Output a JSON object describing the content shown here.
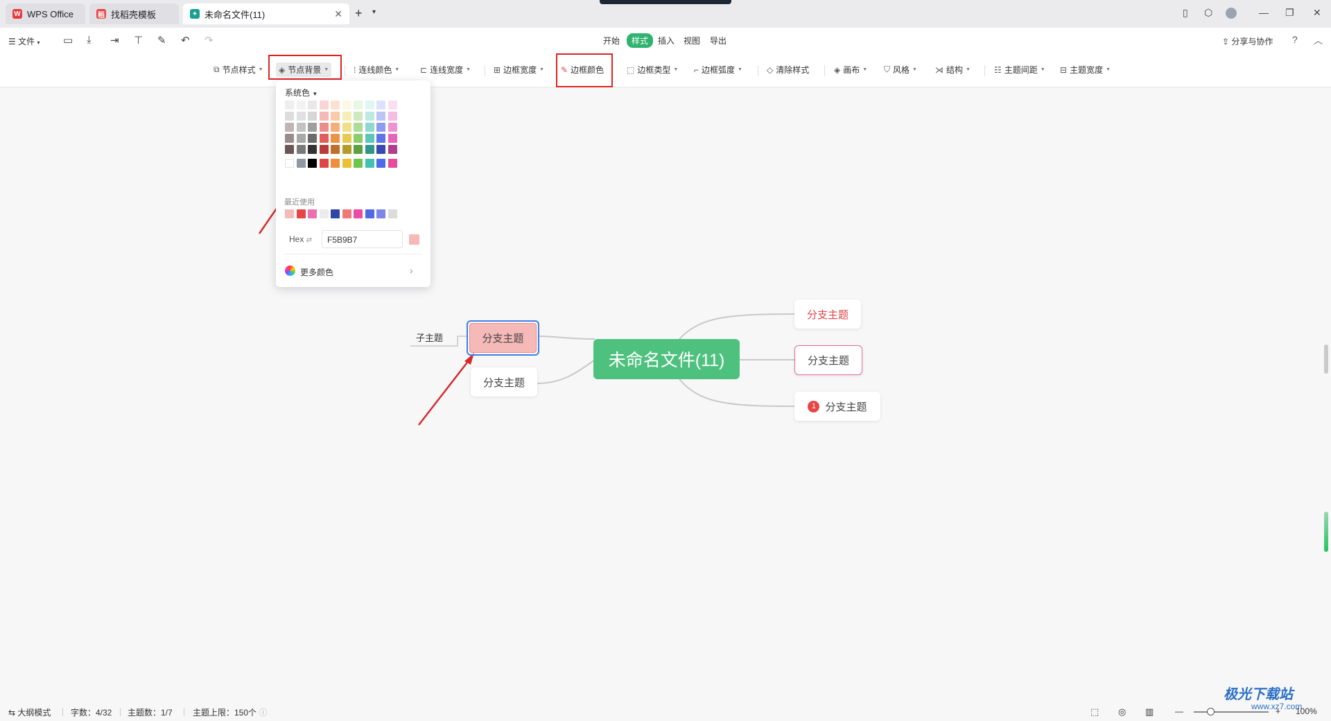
{
  "tabs": [
    {
      "label": "WPS Office"
    },
    {
      "label": "找稻壳模板"
    },
    {
      "label": "未命名文件(11)"
    }
  ],
  "menu": {
    "file_label": "文件",
    "tabs": [
      {
        "label": "开始"
      },
      {
        "label": "样式"
      },
      {
        "label": "插入"
      },
      {
        "label": "视图"
      },
      {
        "label": "导出"
      }
    ],
    "share_label": "分享与协作",
    "help_label": "?"
  },
  "toolbar": {
    "items": [
      {
        "label": "节点样式"
      },
      {
        "label": "节点背景"
      },
      {
        "label": "连线颜色"
      },
      {
        "label": "连线宽度"
      },
      {
        "label": "边框宽度"
      },
      {
        "label": "边框颜色"
      },
      {
        "label": "边框类型"
      },
      {
        "label": "边框弧度"
      },
      {
        "label": "清除样式"
      },
      {
        "label": "画布"
      },
      {
        "label": "风格"
      },
      {
        "label": "结构"
      },
      {
        "label": "主题间距"
      },
      {
        "label": "主题宽度"
      }
    ]
  },
  "color_picker": {
    "system_label": "系统色",
    "palette": [
      [
        "#eeeeee",
        "#f2f2f2",
        "#e8e8e8",
        "#fad4d4",
        "#fce1d1",
        "#fdf8e6",
        "#e8f7e1",
        "#e0f6f3",
        "#dde1fb",
        "#fadff0"
      ],
      [
        "#dddddd",
        "#e0e0e0",
        "#d6d6d6",
        "#f5b9b7",
        "#f9cba8",
        "#f6eeb8",
        "#cdeabf",
        "#bde9e3",
        "#bcc4f7",
        "#f5bde3"
      ],
      [
        "#bfb6b4",
        "#c2c2c2",
        "#9e9e9e",
        "#ec8d8b",
        "#f2b077",
        "#f0df88",
        "#aedb97",
        "#8ed9cf",
        "#8d9cf0",
        "#ee93d0"
      ],
      [
        "#9a8c8a",
        "#a8a8a8",
        "#6b6b6b",
        "#e35e5a",
        "#ec9347",
        "#e6cb52",
        "#8ccc6b",
        "#5cc6b8",
        "#5f74e8",
        "#e864bb"
      ],
      [
        "#6b5654",
        "#7a7a7a",
        "#333333",
        "#b83b38",
        "#bf6e2c",
        "#b59c2a",
        "#5e9f3e",
        "#2f978a",
        "#3947b0",
        "#b03e8d"
      ],
      [
        "#ffffff",
        "#8f98a3",
        "#000000",
        "#e04545",
        "#ef8f3a",
        "#e8c234",
        "#6cc64c",
        "#3fc2b3",
        "#4e6ae8",
        "#e84b9c"
      ]
    ],
    "recent_label": "最近使用",
    "recent": [
      "#f5b9b7",
      "#e84545",
      "#ec6fb0",
      "#ececec",
      "#2f45a8",
      "#f07878",
      "#ec4aa4",
      "#4e6ae8",
      "#7b86e8",
      "#dcdcdc"
    ],
    "hex_label": "Hex",
    "hex_value": "F5B9B7",
    "hex_color": "#f5b9b7",
    "more_label": "更多颜色"
  },
  "mindmap": {
    "center": "未命名文件(11)",
    "selected_node": "分支主题",
    "selected_node_color": "#f5b9b7",
    "left_lower": "分支主题",
    "sub_topic": "子主题",
    "right_top": "分支主题",
    "right_top_text_color": "#e04545",
    "right_middle": "分支主题",
    "right_middle_border_color": "#e86a9a",
    "right_bottom": "分支主题",
    "right_bottom_badge": "1",
    "center_color": "#4fc17f"
  },
  "status": {
    "outline_mode": "大纲模式",
    "word_count": "字数：4/32",
    "topic_count": "主题数：1/7",
    "topic_limit": "主题上限：150个",
    "zoom": "100%"
  },
  "watermark": {
    "title": "极光下载站",
    "url": "www.xz7.com"
  },
  "colors": {
    "accent_green": "#2fb36f",
    "highlight_red": "#e02020",
    "selection_blue": "#3b7fe6"
  }
}
